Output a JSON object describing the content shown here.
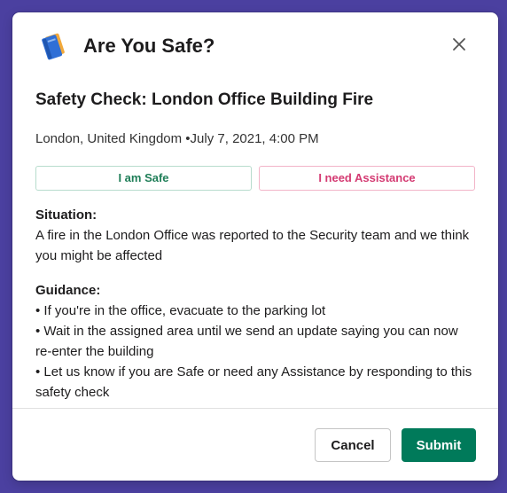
{
  "modal": {
    "title": "Are You Safe?",
    "close_icon": "close-icon",
    "app_icon": "notebook-icon"
  },
  "check": {
    "title": "Safety Check: London Office Building Fire",
    "location": "London, United Kingdom",
    "separator": " •",
    "datetime": "July 7, 2021, 4:00 PM"
  },
  "responses": {
    "safe_label": "I am Safe",
    "assist_label": "I need Assistance"
  },
  "situation": {
    "label": "Situation:",
    "text": "A fire in the London Office was reported to the Security team and we think you might be affected"
  },
  "guidance": {
    "label": "Guidance:",
    "items": [
      "• If you're in the office, evacuate to the parking lot",
      "• Wait in the assigned area until we send an update saying you can now re-enter the building",
      "• Let us know if you are Safe or need any Assistance by responding to this safety check"
    ]
  },
  "footer": {
    "cancel_label": "Cancel",
    "submit_label": "Submit"
  },
  "colors": {
    "backdrop": "#4b40a0",
    "safe": "#1f7e58",
    "assist": "#d43a72",
    "submit": "#007a5a"
  }
}
